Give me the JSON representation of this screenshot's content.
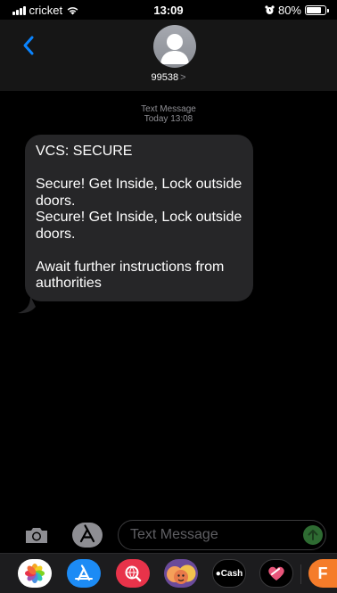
{
  "status_bar": {
    "carrier": "cricket",
    "time": "13:09",
    "battery": "80%",
    "battery_level": 0.8
  },
  "header": {
    "contact_name": "99538",
    "chevron": ">"
  },
  "thread": {
    "meta_type": "Text Message",
    "meta_time": "Today 13:08",
    "messages": [
      {
        "lines": [
          "VCS: SECURE",
          "",
          "Secure! Get Inside, Lock outside doors.",
          "Secure! Get Inside, Lock outside doors.",
          "",
          "Await further instructions from authorities"
        ]
      }
    ]
  },
  "input": {
    "placeholder": "Text Message"
  },
  "app_drawer": {
    "apps": [
      {
        "name": "photos",
        "icon": "photos-icon",
        "color": "#ffffff"
      },
      {
        "name": "app-store",
        "icon": "app-store-icon",
        "color": "#1c8bf5"
      },
      {
        "name": "web-search",
        "icon": "search-images-icon",
        "color": "#e8334a"
      },
      {
        "name": "memoji",
        "icon": "memoji-icon",
        "color": "#6a4a9a"
      },
      {
        "name": "apple-cash",
        "icon": "apple-cash-icon",
        "label": "Cash",
        "color": "#000000"
      },
      {
        "name": "digital-touch",
        "icon": "digital-touch-icon",
        "color": "#000000"
      },
      {
        "name": "fandango",
        "icon": "fandango-icon",
        "color": "#f57c2a"
      }
    ]
  },
  "colors": {
    "accent": "#0a84ff",
    "bubble_received": "#262628",
    "header_bg": "#161616",
    "send_button": "#2e6b32"
  }
}
